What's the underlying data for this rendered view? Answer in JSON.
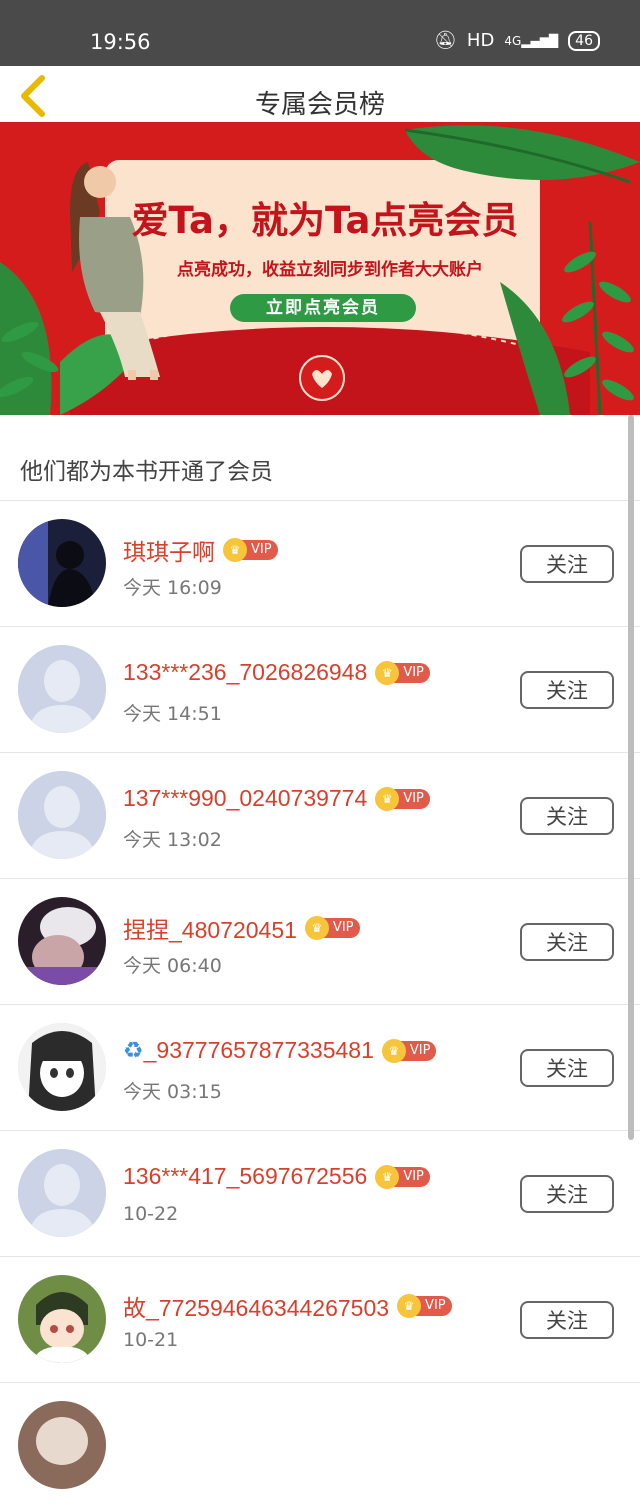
{
  "status_bar": {
    "time": "19:56",
    "network": "HD",
    "signal": "4G",
    "battery": "46"
  },
  "header": {
    "title": "专属会员榜"
  },
  "banner": {
    "headline": "爱Ta，就为Ta点亮会员",
    "subline": "点亮成功，收益立刻同步到作者大大账户",
    "cta_label": "立即点亮会员"
  },
  "section": {
    "title": "他们都为本书开通了会员"
  },
  "vip_label": "VIP",
  "follow_label": "关注",
  "members": [
    {
      "name": "琪琪子啊",
      "time": "今天 16:09"
    },
    {
      "name": "133***236_7026826948",
      "time": "今天 14:51"
    },
    {
      "name": "137***990_0240739774",
      "time": "今天 13:02"
    },
    {
      "name": "捏捏_480720451",
      "time": "今天 06:40"
    },
    {
      "name": "_93777657877335481",
      "time": "今天 03:15"
    },
    {
      "name": "136***417_5697672556",
      "time": "10-22"
    },
    {
      "name": "故_772594646344267503",
      "time": "10-21"
    }
  ]
}
